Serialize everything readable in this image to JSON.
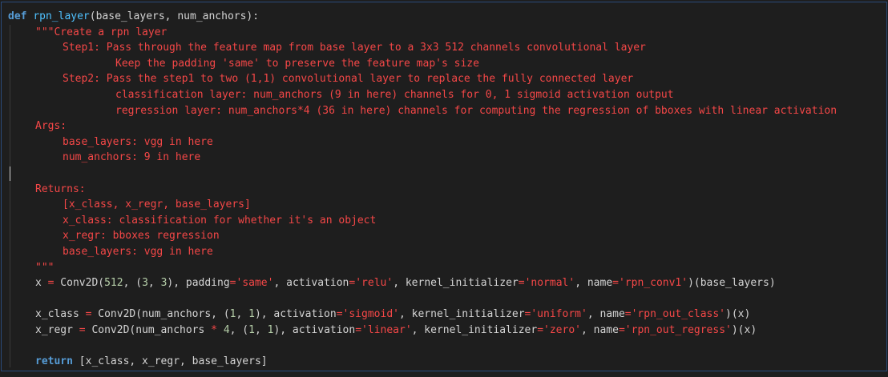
{
  "code": {
    "l1": {
      "kw": "def",
      "fn": "rpn_layer",
      "rest": "(base_layers, num_anchors):"
    },
    "l2": "\"\"\"Create a rpn layer",
    "l3": "Step1: Pass through the feature map from base layer to a 3x3 512 channels convolutional layer",
    "l4": "Keep the padding 'same' to preserve the feature map's size",
    "l5": "Step2: Pass the step1 to two (1,1) convolutional layer to replace the fully connected layer",
    "l6": "classification layer: num_anchors (9 in here) channels for 0, 1 sigmoid activation output",
    "l7": "regression layer: num_anchors*4 (36 in here) channels for computing the regression of bboxes with linear activation",
    "l8": "Args:",
    "l9": "base_layers: vgg in here",
    "l10": "num_anchors: 9 in here",
    "l12": "Returns:",
    "l13": "[x_class, x_regr, base_layers]",
    "l14": "x_class: classification for whether it's an object",
    "l15": "x_regr: bboxes regression",
    "l16": "base_layers: vgg in here",
    "l17": "\"\"\"",
    "l18": {
      "a": "x ",
      "eq": "=",
      "b": " Conv2D(",
      "n1": "512",
      "c": ", (",
      "n2": "3",
      "d": ", ",
      "n3": "3",
      "e": "), padding",
      "eq2": "=",
      "s1": "'same'",
      "f": ", activation",
      "eq3": "=",
      "s2": "'relu'",
      "g": ", kernel_initializer",
      "eq4": "=",
      "s3": "'normal'",
      "h": ", name",
      "eq5": "=",
      "s4": "'rpn_conv1'",
      "i": ")(base_layers)"
    },
    "l20": {
      "a": "x_class ",
      "eq": "=",
      "b": " Conv2D(num_anchors, (",
      "n1": "1",
      "c": ", ",
      "n2": "1",
      "d": "), activation",
      "eq2": "=",
      "s1": "'sigmoid'",
      "e": ", kernel_initializer",
      "eq3": "=",
      "s2": "'uniform'",
      "f": ", name",
      "eq4": "=",
      "s3": "'rpn_out_class'",
      "g": ")(x)"
    },
    "l21": {
      "a": "x_regr ",
      "eq": "=",
      "b": " Conv2D(num_anchors ",
      "op": "*",
      "b2": " ",
      "n0": "4",
      "b3": ", (",
      "n1": "1",
      "c": ", ",
      "n2": "1",
      "d": "), activation",
      "eq2": "=",
      "s1": "'linear'",
      "e": ", kernel_initializer",
      "eq3": "=",
      "s2": "'zero'",
      "f": ", name",
      "eq4": "=",
      "s3": "'rpn_out_regress'",
      "g": ")(x)"
    },
    "l23": {
      "kw": "return",
      "rest": " [x_class, x_regr, base_layers]"
    }
  }
}
